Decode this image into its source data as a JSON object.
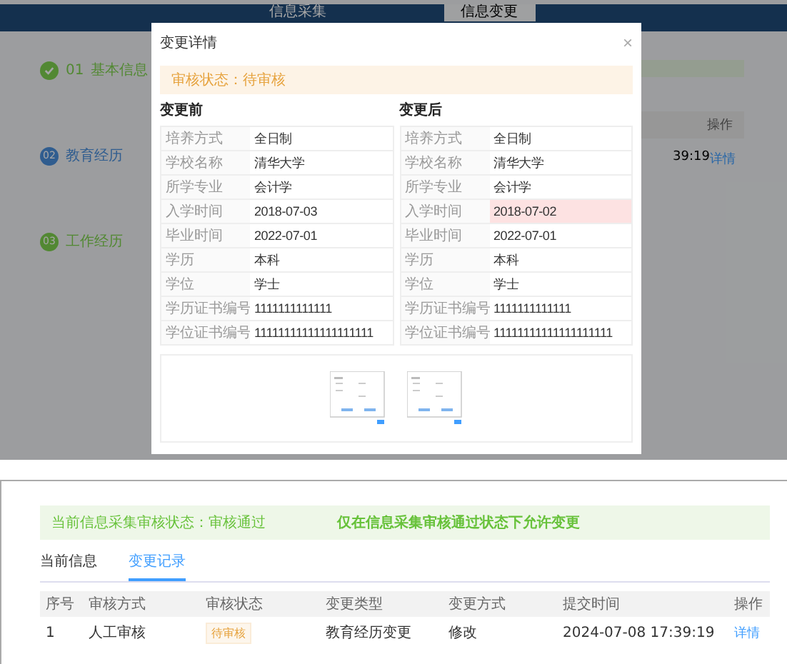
{
  "background_page": {
    "nav_tabs": [
      {
        "label": "信息采集",
        "selected": false
      },
      {
        "label": "信息变更",
        "selected": true
      }
    ],
    "steps": [
      {
        "number": "01",
        "label": "基本信息",
        "completed": true,
        "current": false
      },
      {
        "number": "02",
        "label": "教育经历",
        "completed": false,
        "current": true
      },
      {
        "number": "03",
        "label": "工作经历",
        "completed": false,
        "current": false
      }
    ],
    "table_header_fragment": "操作",
    "time_fragment": "39:19",
    "detail_link": "详情"
  },
  "modal": {
    "title": "变更详情",
    "close": "×",
    "status_notice": "审核状态：待审核",
    "before": {
      "title": "变更前",
      "rows": [
        {
          "label": "培养方式",
          "value": "全日制"
        },
        {
          "label": "学校名称",
          "value": "清华大学"
        },
        {
          "label": "所学专业",
          "value": "会计学"
        },
        {
          "label": "入学时间",
          "value": "2018-07-03"
        },
        {
          "label": "毕业时间",
          "value": "2022-07-01"
        },
        {
          "label": "学历",
          "value": "本科"
        },
        {
          "label": "学位",
          "value": "学士"
        },
        {
          "label": "学历证书编号",
          "value": "1111111111111"
        },
        {
          "label": "学位证书编号",
          "value": "11111111111111111111"
        }
      ]
    },
    "after": {
      "title": "变更后",
      "rows": [
        {
          "label": "培养方式",
          "value": "全日制",
          "changed": false
        },
        {
          "label": "学校名称",
          "value": "清华大学",
          "changed": false
        },
        {
          "label": "所学专业",
          "value": "会计学",
          "changed": false
        },
        {
          "label": "入学时间",
          "value": "2018-07-02",
          "changed": true
        },
        {
          "label": "毕业时间",
          "value": "2022-07-01",
          "changed": false
        },
        {
          "label": "学历",
          "value": "本科",
          "changed": false
        },
        {
          "label": "学位",
          "value": "学士",
          "changed": false
        },
        {
          "label": "学历证书编号",
          "value": "1111111111111",
          "changed": false
        },
        {
          "label": "学位证书编号",
          "value": "11111111111111111111",
          "changed": false
        }
      ]
    }
  },
  "record_panel": {
    "status_text": "当前信息采集审核状态：审核通过",
    "notice": "仅在信息采集审核通过状态下允许变更",
    "tabs": [
      {
        "label": "当前信息",
        "selected": false
      },
      {
        "label": "变更记录",
        "selected": true
      }
    ],
    "table": {
      "columns": [
        "序号",
        "审核方式",
        "审核状态",
        "变更类型",
        "变更方式",
        "提交时间",
        "操作"
      ],
      "rows": [
        {
          "index": "1",
          "method": "人工审核",
          "status": "待审核",
          "change_type": "教育经历变更",
          "change_mode": "修改",
          "submitted": "2024-07-08 17:39:19",
          "action": "详情"
        }
      ]
    }
  }
}
